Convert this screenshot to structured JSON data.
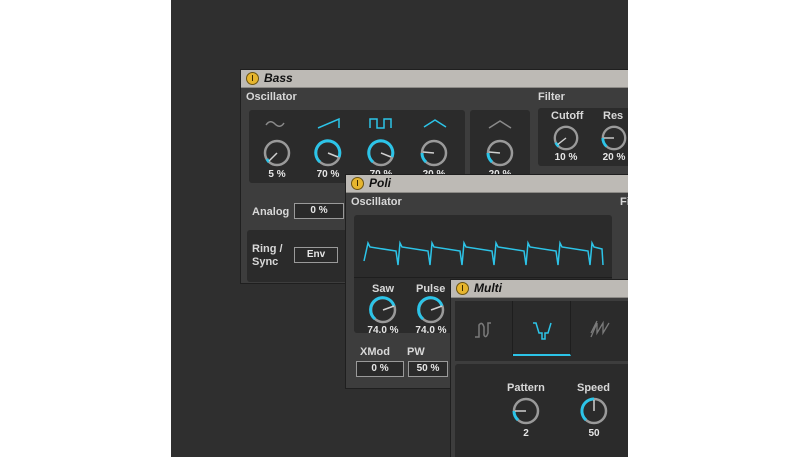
{
  "bass": {
    "title": "Bass",
    "osc_label": "Oscillator",
    "filter_label": "Filter",
    "osc_values": [
      "5 %",
      "70 %",
      "70 %",
      "20 %",
      "20 %"
    ],
    "cutoff_label": "Cutoff",
    "cutoff_value": "10 %",
    "res_label": "Res",
    "res_value": "20 %",
    "analog_label": "Analog",
    "analog_value": "0 %",
    "ring_label": "Ring /",
    "sync_label": "Sync",
    "env_label": "Env"
  },
  "poli": {
    "title": "Poli",
    "osc_label": "Oscillator",
    "filter_label_partial": "Fi",
    "saw_label": "Saw",
    "saw_value": "74.0 %",
    "pulse_label": "Pulse",
    "pulse_value": "74.0 %",
    "xmod_label": "XMod",
    "xmod_value": "0 %",
    "pw_label": "PW",
    "pw_value": "50 %"
  },
  "multi": {
    "title": "Multi",
    "pattern_label": "Pattern",
    "pattern_value": "2",
    "speed_label": "Speed",
    "speed_value": "50"
  },
  "colors": {
    "accent": "#2cc4e8",
    "panel": "#2b2b2b",
    "device": "#3d3d3d",
    "titlebar": "#bdbab5",
    "power": "#e6b52e"
  }
}
